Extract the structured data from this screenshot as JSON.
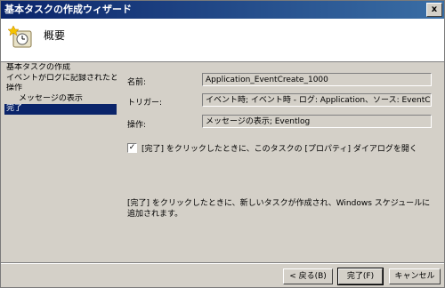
{
  "window": {
    "title": "基本タスクの作成ウィザード",
    "close_glyph": "x"
  },
  "header": {
    "title": "概要",
    "icon": "task-clock-icon"
  },
  "sidebar": {
    "items": [
      {
        "label": "基本タスクの作成"
      },
      {
        "label": "イベントがログに記録されたとき"
      },
      {
        "label": "操作"
      },
      {
        "label": "メッセージの表示"
      },
      {
        "label": "完了"
      }
    ]
  },
  "summary": {
    "name_label": "名前:",
    "name_value": "Application_EventCreate_1000",
    "trigger_label": "トリガー:",
    "trigger_value": "イベント時; イベント時 - ログ: Application、ソース: EventCreate、",
    "action_label": "操作:",
    "action_value": "メッセージの表示; Eventlog"
  },
  "checkbox": {
    "checked_glyph": "✓",
    "label": "[完了] をクリックしたときに、このタスクの [プロパティ] ダイアログを開く"
  },
  "info_text": "[完了] をクリックしたときに、新しいタスクが作成され、Windows スケジュールに追加されます。",
  "buttons": {
    "back": "< 戻る(B)",
    "finish": "完了(F)",
    "cancel": "キャンセル"
  }
}
